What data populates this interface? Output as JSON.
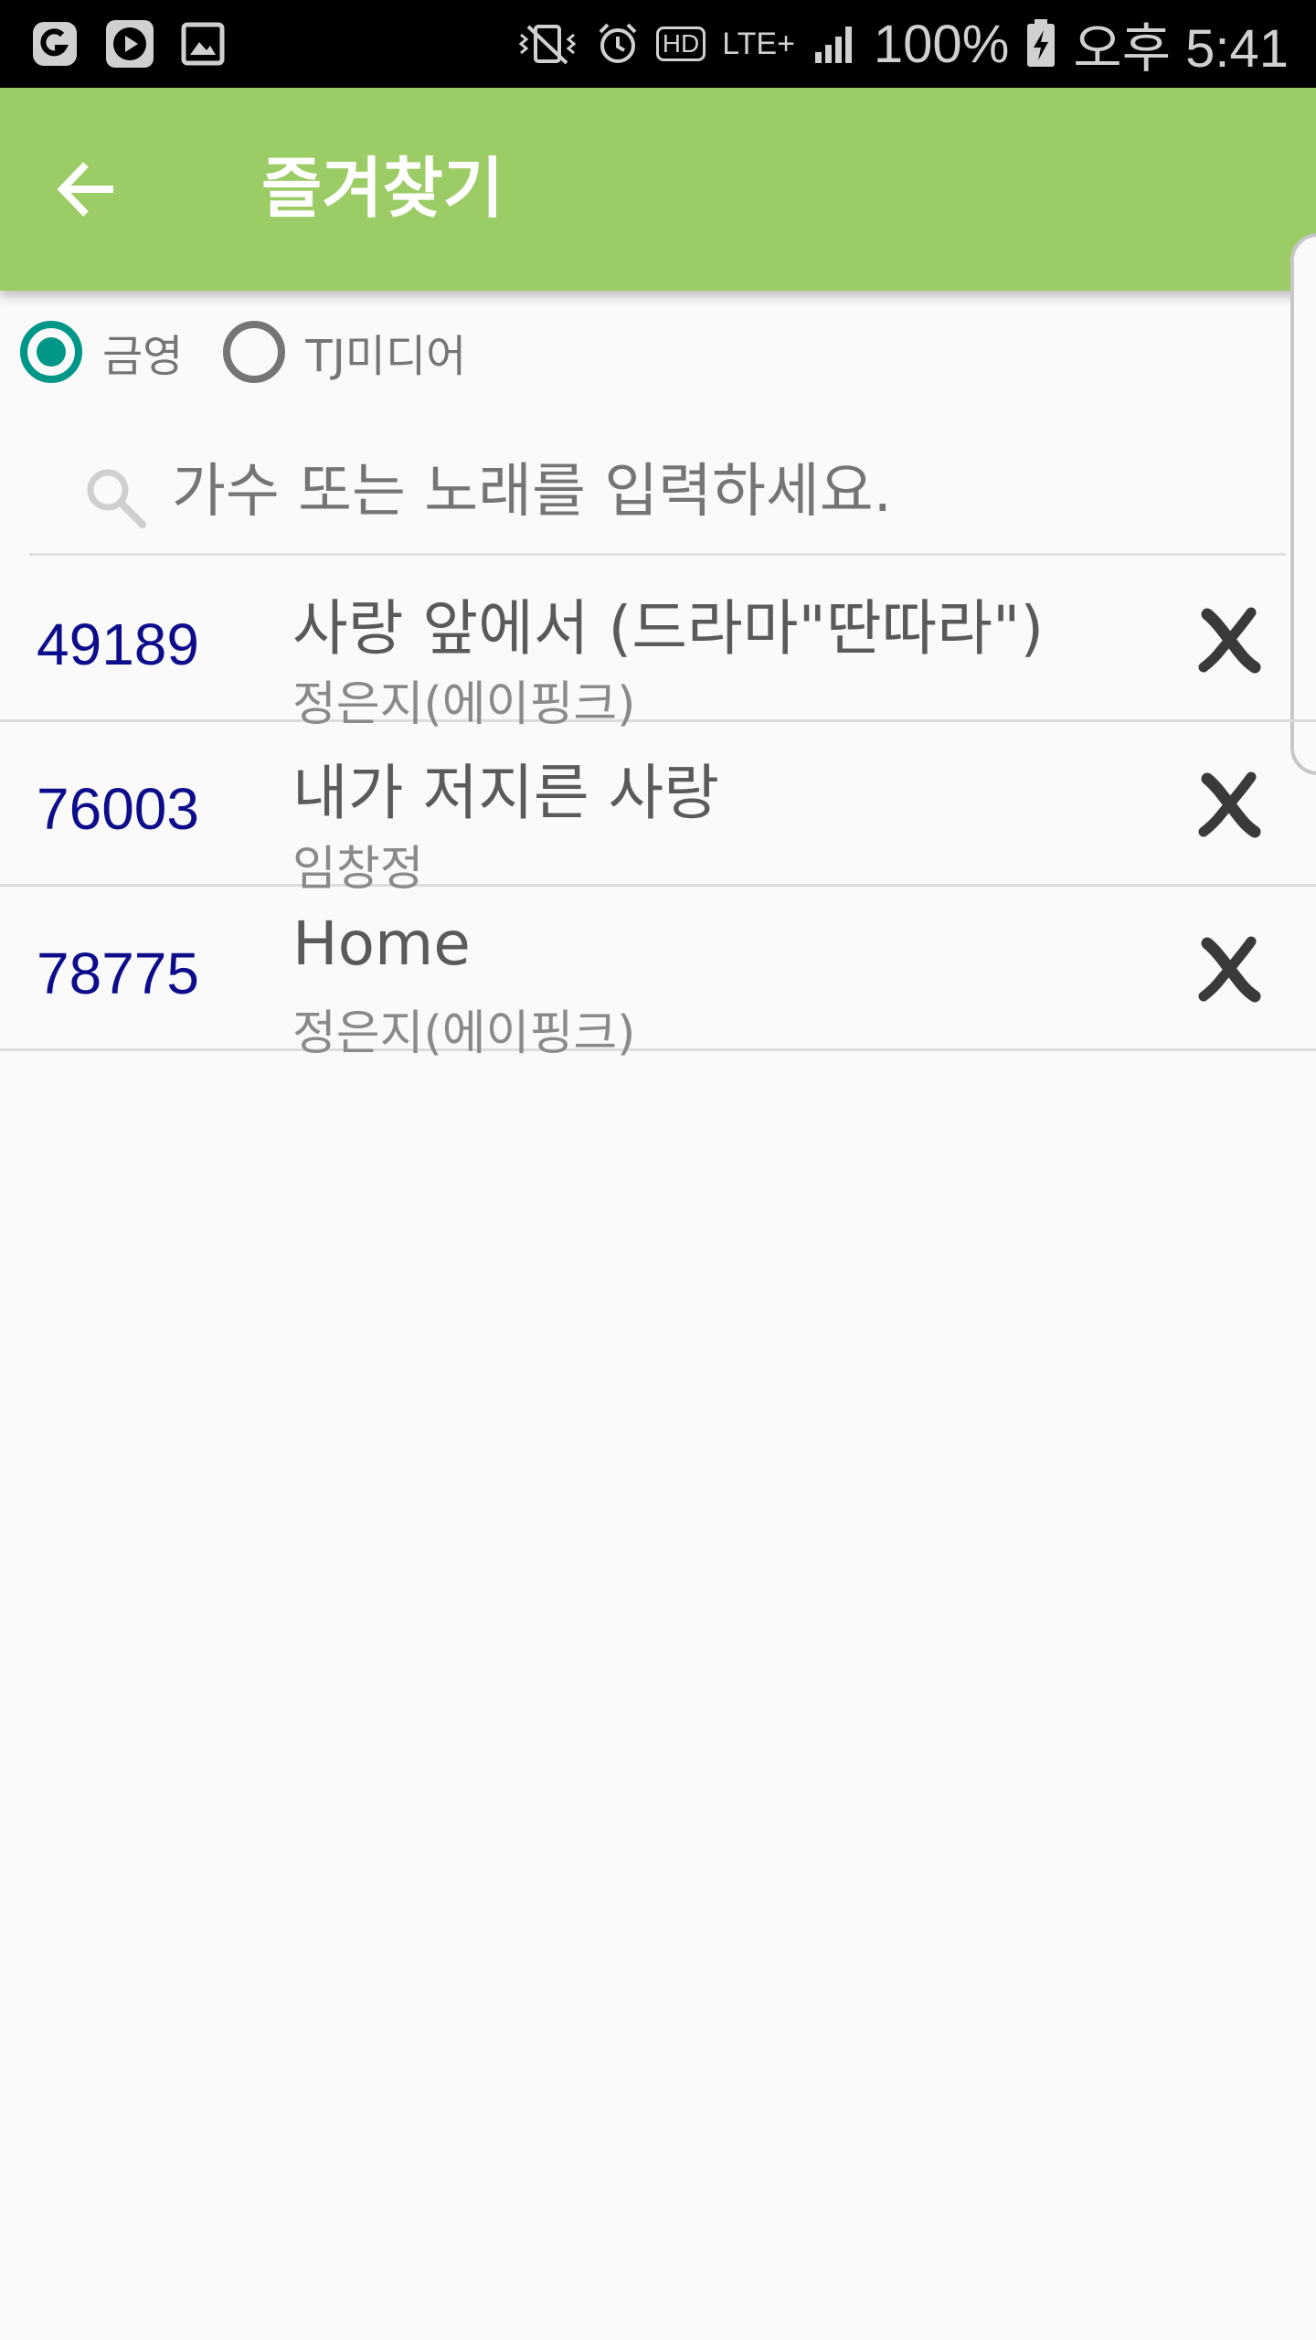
{
  "status_bar": {
    "left_icons": [
      "circle-app-icon",
      "play-icon",
      "gallery-icon"
    ],
    "right_icons": [
      "vibrate-mute-icon",
      "alarm-icon",
      "hd-icon",
      "lte-icon",
      "signal-icon",
      "battery-charging-icon"
    ],
    "hd": "HD",
    "network": "LTE+",
    "battery": "100%",
    "time": "오후 5:41"
  },
  "app_bar": {
    "title": "즐겨찾기",
    "background": "#9ccc65",
    "back_icon": "arrow-back-icon"
  },
  "source_selector": {
    "options": [
      {
        "label": "금영",
        "selected": true
      },
      {
        "label": "TJ미디어",
        "selected": false
      }
    ],
    "accent": "#009688"
  },
  "search": {
    "placeholder": "가수 또는 노래를 입력하세요.",
    "value": "",
    "icon": "search-icon"
  },
  "favorites": [
    {
      "number": "49189",
      "title": "사랑 앞에서 (드라마\"딴따라\")",
      "artist": "정은지(에이핑크)",
      "action_icon": "delete-x-icon"
    },
    {
      "number": "76003",
      "title": "내가 저지른 사랑",
      "artist": "임창정",
      "action_icon": "delete-x-icon"
    },
    {
      "number": "78775",
      "title": "Home",
      "artist": "정은지(에이핑크)",
      "action_icon": "delete-x-icon"
    }
  ]
}
